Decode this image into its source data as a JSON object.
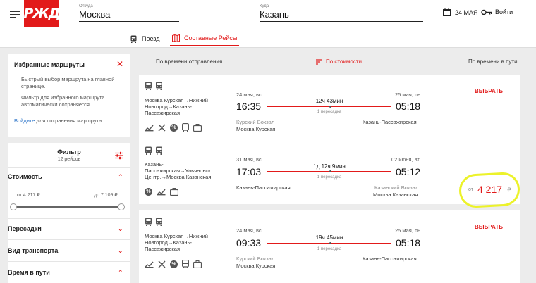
{
  "header": {
    "logo_text": "РЖД",
    "from_label": "Откуда",
    "from_value": "Москва",
    "to_label": "Куда",
    "to_value": "Казань",
    "date": "24 МАЯ",
    "login": "Войти"
  },
  "tabs": [
    {
      "label": "Поезд",
      "active": false
    },
    {
      "label": "Составные Рейсы",
      "active": true
    }
  ],
  "favorites": {
    "title": "Избранные маршруты",
    "text1": "Быстрый выбор маршрута на главной странице.",
    "text2": "Фильтр для избранного маршрута автоматически сохраняется.",
    "login_link": "Войдите",
    "login_suffix": "для сохранения маршрута."
  },
  "filter": {
    "title": "Фильтр",
    "count": "12 рейсов",
    "cost_label": "Стоимость",
    "price_from": "от 4 217 ₽",
    "price_to": "до 7 109 ₽",
    "sections": [
      "Пересадки",
      "Вид транспорта",
      "Время в пути"
    ]
  },
  "sort": {
    "by_departure": "По времени отправления",
    "by_price": "По стоимости",
    "by_duration": "По времени в пути"
  },
  "results": [
    {
      "stations": "Москва Курская→Нижний Новгород→Казань-Пассажирская",
      "dep_date": "24 мая, вс",
      "dep_time": "16:35",
      "duration": "12ч 43мин",
      "transfers": "1 пересадка",
      "arr_date": "25 мая, пн",
      "arr_time": "05:18",
      "dep_station_sub": "Курский Вокзал",
      "dep_station": "Москва Курская",
      "arr_station_sub": "",
      "arr_station": "Казань-Пассажирская",
      "action": "ВЫБРАТЬ",
      "amenities": [
        "chart-icon",
        "dining-icon",
        "discount-icon",
        "bus-icon",
        "luggage-icon"
      ]
    },
    {
      "stations": "Казань-Пассажирская→Ульяновск Центр.→Москва Казанская",
      "dep_date": "31 мая, вс",
      "dep_time": "17:03",
      "duration": "1д 12ч 9мин",
      "transfers": "1 пересадка",
      "arr_date": "02 июня, вт",
      "arr_time": "05:12",
      "dep_station_sub": "",
      "dep_station": "Казань-Пассажирская",
      "arr_station_sub": "Казанский Вокзал",
      "arr_station": "Москва Казанская",
      "price_prefix": "от",
      "price": "4 217",
      "currency": "₽",
      "amenities": [
        "discount-icon",
        "chart-icon",
        "luggage-icon"
      ]
    },
    {
      "stations": "Москва Курская→Нижний Новгород→Казань-Пассажирская",
      "dep_date": "24 мая, вс",
      "dep_time": "09:33",
      "duration": "19ч 45мин",
      "transfers": "1 пересадка",
      "arr_date": "25 мая, пн",
      "arr_time": "05:18",
      "dep_station_sub": "Курский Вокзал",
      "dep_station": "Москва Курская",
      "arr_station_sub": "",
      "arr_station": "Казань-Пассажирская",
      "action": "ВЫБРАТЬ",
      "amenities": [
        "chart-icon",
        "dining-icon",
        "discount-icon",
        "bus-icon",
        "luggage-icon"
      ]
    }
  ],
  "colors": {
    "brand_red": "#e21a1a",
    "link_blue": "#2a73c8",
    "highlight": "#ecf22a"
  }
}
